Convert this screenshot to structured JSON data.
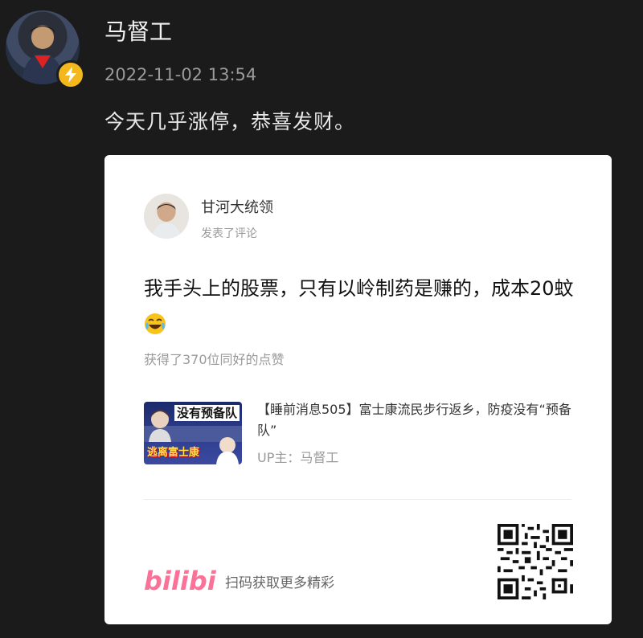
{
  "post": {
    "username": "马督工",
    "timestamp": "2022-11-02 13:54",
    "text": "今天几乎涨停，恭喜发财。"
  },
  "card": {
    "commenter": "甘河大统领",
    "action": "发表了评论",
    "comment": "我手头上的股票，只有以岭制药是赚的，成本20蚊",
    "likes": "获得了370位同好的点赞",
    "video": {
      "thumb_top": "没有预备队",
      "thumb_bottom": "逃离富士康",
      "title": "【睡前消息505】富士康流民步行返乡，防疫没有“预备队”",
      "uploader": "UP主：马督工"
    },
    "footer": {
      "logo_text": "bilibili",
      "scan_text": "扫码获取更多精彩"
    }
  },
  "colors": {
    "background": "#1b1b1b",
    "card": "#ffffff",
    "bilibili_pink": "#fb7299",
    "badge": "#f4b81f"
  }
}
